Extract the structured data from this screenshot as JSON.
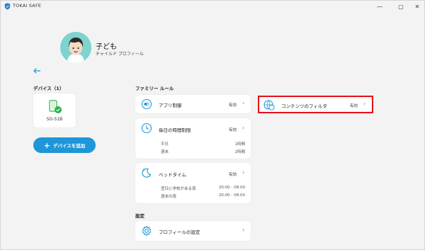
{
  "window": {
    "title": "TOKAI SAFE",
    "controls": {
      "minimize": "—",
      "maximize": "▢",
      "close": "✕"
    }
  },
  "profile": {
    "name": "子ども",
    "type": "チャイルド プロフィール"
  },
  "devices": {
    "label": "デバイス（1）",
    "items": [
      {
        "name": "SO-51B"
      }
    ],
    "add_button": "デバイスを追加"
  },
  "family_rules": {
    "label": "ファミリー ルール",
    "app_control": {
      "title": "アプリ制御",
      "status": "有効"
    },
    "daily_time_limit": {
      "title": "毎日の時間制限",
      "status": "有効",
      "rows": [
        {
          "label": "平日",
          "value": "1時間"
        },
        {
          "label": "週末",
          "value": "2時間"
        }
      ]
    },
    "bedtime": {
      "title": "ベッドタイム",
      "status": "有効",
      "rows": [
        {
          "label": "翌日に学校がある夜",
          "value": "20:00 - 08:00"
        },
        {
          "label": "週末の夜",
          "value": "20:00 - 08:00"
        }
      ]
    },
    "content_filter": {
      "title": "コンテンツのフィルタ",
      "status": "有効"
    }
  },
  "settings": {
    "label": "設定",
    "profile_settings": {
      "title": "プロフィールの設定"
    }
  },
  "colors": {
    "accent": "#1e96d8",
    "highlight": "#e8101a",
    "avatar_bg": "#7fd3cf",
    "check": "#2bb24c"
  }
}
